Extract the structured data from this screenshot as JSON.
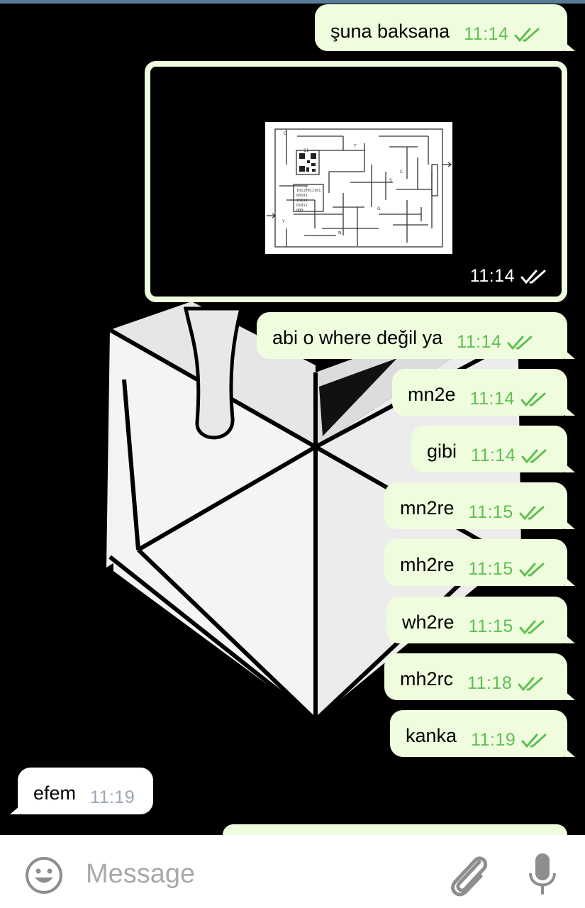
{
  "messages": [
    {
      "text": "şuna baksana",
      "time": "11:14"
    },
    {
      "text": "abi o where değil ya",
      "time": "11:14"
    },
    {
      "text": "mn2e",
      "time": "11:14"
    },
    {
      "text": "gibi",
      "time": "11:14"
    },
    {
      "text": "mn2re",
      "time": "11:15"
    },
    {
      "text": "mh2re",
      "time": "11:15"
    },
    {
      "text": "wh2re",
      "time": "11:15"
    },
    {
      "text": "mh2rc",
      "time": "11:18"
    },
    {
      "text": "kanka",
      "time": "11:19"
    }
  ],
  "media_message": {
    "time": "11:14"
  },
  "incoming": [
    {
      "text": "efem",
      "time": "11:19"
    }
  ],
  "maze_labels": [
    "O",
    "T",
    "S",
    "C",
    "T",
    "G",
    "Y",
    "N",
    "11"
  ],
  "maze_binary": [
    "10110011101",
    "00101",
    "10110",
    "01011",
    "000"
  ],
  "input": {
    "placeholder": "Message"
  },
  "icons": {
    "emoji": "smiley-icon",
    "attach": "paperclip-icon",
    "mic": "microphone-icon",
    "read": "double-check-icon"
  },
  "colors": {
    "outgoing_bubble": "#effdde",
    "incoming_bubble": "#ffffff",
    "time_out": "#5fbf52",
    "time_in": "#9aa7b2",
    "background": "#000000"
  }
}
